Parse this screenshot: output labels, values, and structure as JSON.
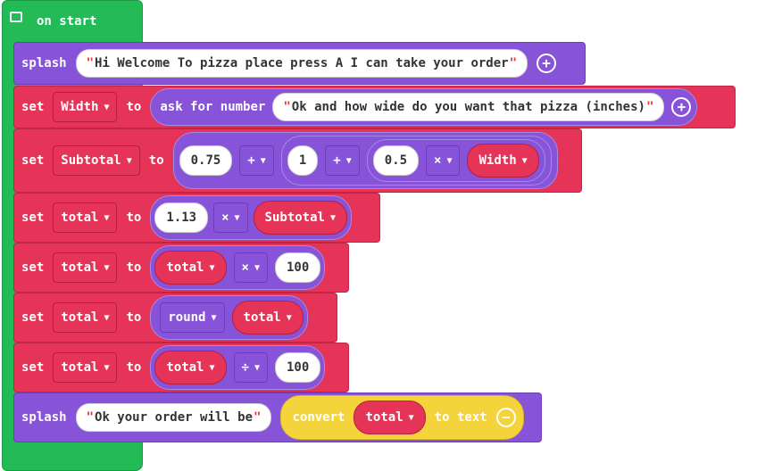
{
  "hat": {
    "label": "on start"
  },
  "block1": {
    "kw": "splash",
    "text": "Hi Welcome To pizza place  press A I can take your order"
  },
  "block2": {
    "kw": "set",
    "var": "Width",
    "to": "to",
    "fn": "ask for number",
    "text": "Ok and how wide do you want that pizza (inches)"
  },
  "block3": {
    "kw": "set",
    "var": "Subtotal",
    "to": "to",
    "n1": "0.75",
    "op1": "+",
    "n2": "1",
    "op2": "+",
    "n3": "0.5",
    "op3": "×",
    "ref": "Width"
  },
  "block4": {
    "kw": "set",
    "var": "total",
    "to": "to",
    "n1": "1.13",
    "op": "×",
    "ref": "Subtotal"
  },
  "block5": {
    "kw": "set",
    "var": "total",
    "to": "to",
    "ref": "total",
    "op": "×",
    "n": "100"
  },
  "block6": {
    "kw": "set",
    "var": "total",
    "to": "to",
    "fn": "round",
    "ref": "total"
  },
  "block7": {
    "kw": "set",
    "var": "total",
    "to": "to",
    "ref": "total",
    "op": "÷",
    "n": "100"
  },
  "block8": {
    "kw": "splash",
    "text": "Ok your order will be",
    "conv": "convert",
    "ref": "total",
    "to_text": "to text"
  },
  "icons": {
    "comment": "comment-icon",
    "add": "plus-circle-icon",
    "remove": "minus-circle-icon",
    "dropdown": "caret-down-icon"
  },
  "colors": {
    "events": "#22bb55",
    "basic": "#8753d8",
    "variables": "#e63358",
    "text": "#f5d33a"
  }
}
